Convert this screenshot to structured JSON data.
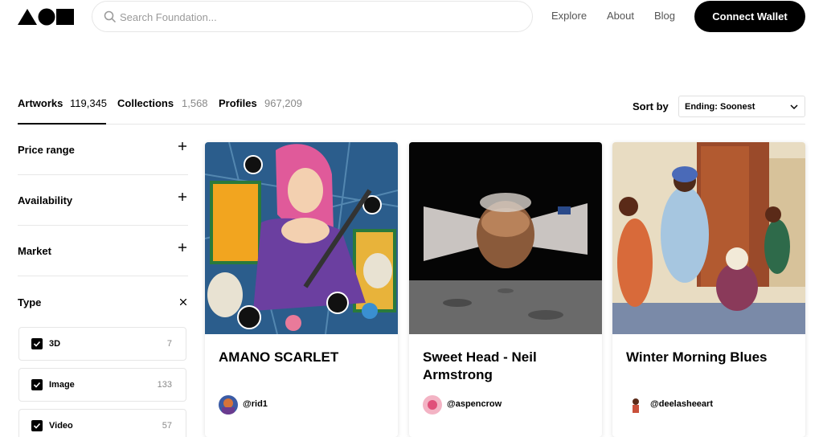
{
  "header": {
    "search_placeholder": "Search Foundation...",
    "nav": [
      "Explore",
      "About",
      "Blog"
    ],
    "connect_label": "Connect Wallet"
  },
  "tabs": [
    {
      "label": "Artworks",
      "count": "119,345",
      "active": true
    },
    {
      "label": "Collections",
      "count": "1,568",
      "active": false
    },
    {
      "label": "Profiles",
      "count": "967,209",
      "active": false
    }
  ],
  "sort": {
    "label": "Sort by",
    "value": "Ending: Soonest"
  },
  "filters": [
    {
      "label": "Price range",
      "toggle": "plus-icon"
    },
    {
      "label": "Availability",
      "toggle": "plus-icon"
    },
    {
      "label": "Market",
      "toggle": "plus-icon"
    },
    {
      "label": "Type",
      "toggle": "close-icon"
    }
  ],
  "type_options": [
    {
      "label": "3D",
      "count": "7",
      "checked": true
    },
    {
      "label": "Image",
      "count": "133",
      "checked": true
    },
    {
      "label": "Video",
      "count": "57",
      "checked": true
    }
  ],
  "cards": [
    {
      "title": "AMANO SCARLET",
      "creator": "@rid1"
    },
    {
      "title": "Sweet Head - Neil Armstrong",
      "creator": "@aspencrow"
    },
    {
      "title": "Winter Morning Blues",
      "creator": "@deelasheeart"
    }
  ],
  "colors": {
    "accent": "#000000",
    "border": "#e6e6e6"
  }
}
